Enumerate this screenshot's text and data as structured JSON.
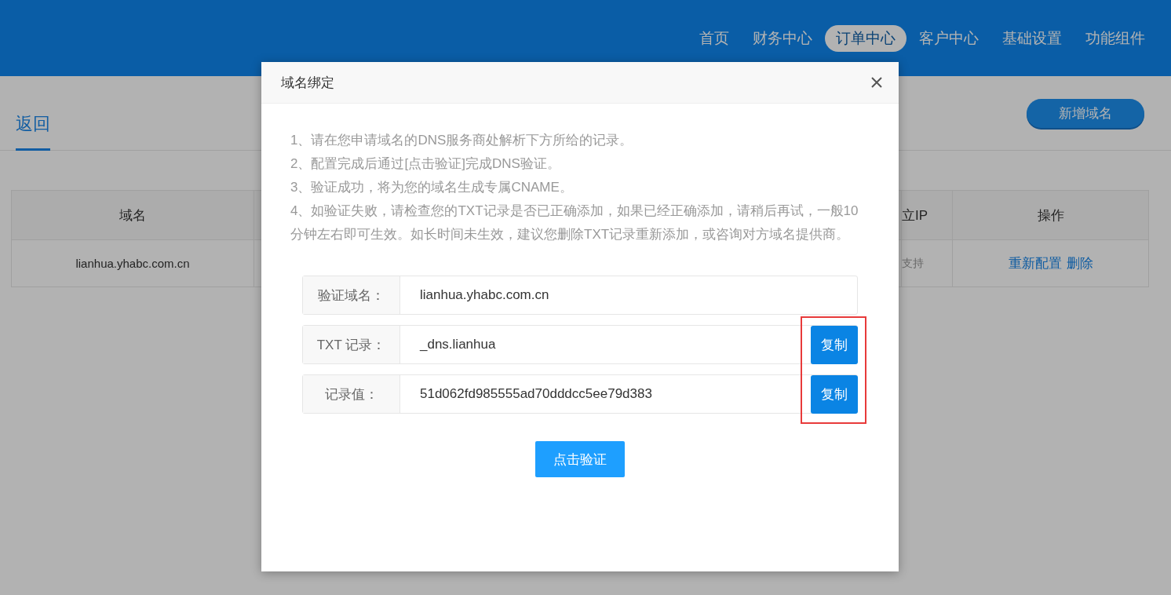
{
  "nav": [
    {
      "label": "首页",
      "selected": false
    },
    {
      "label": "财务中心",
      "selected": false
    },
    {
      "label": "订单中心",
      "selected": true
    },
    {
      "label": "客户中心",
      "selected": false
    },
    {
      "label": "基础设置",
      "selected": false
    },
    {
      "label": "功能组件",
      "selected": false
    }
  ],
  "page": {
    "back_tab": "返回",
    "add_button": "新增域名"
  },
  "table": {
    "columns": [
      "域名",
      "立IP",
      "操作"
    ],
    "rows": [
      {
        "domain": "lianhua.yhabc.com.cn",
        "ip": "支持",
        "actions": [
          "重新配置",
          "删除"
        ]
      }
    ]
  },
  "dialog": {
    "title": "域名绑定",
    "instructions": [
      "1、请在您申请域名的DNS服务商处解析下方所给的记录。",
      "2、配置完成后通过[点击验证]完成DNS验证。",
      "3、验证成功，将为您的域名生成专属CNAME。",
      "4、如验证失败，请检查您的TXT记录是否已正确添加，如果已经正确添加，请稍后再试，一般10分钟左右即可生效。如长时间未生效，建议您删除TXT记录重新添加，或咨询对方域名提供商。"
    ],
    "fields": [
      {
        "label": "验证域名：",
        "value": "lianhua.yhabc.com.cn"
      },
      {
        "label": "TXT 记录：",
        "value": "_dns.lianhua",
        "copy_button": "复制"
      },
      {
        "label": "记录值：",
        "value": "51d062fd985555ad70dddcc5ee79d383",
        "copy_button": "复制"
      }
    ],
    "verify_button": "点击验证"
  }
}
